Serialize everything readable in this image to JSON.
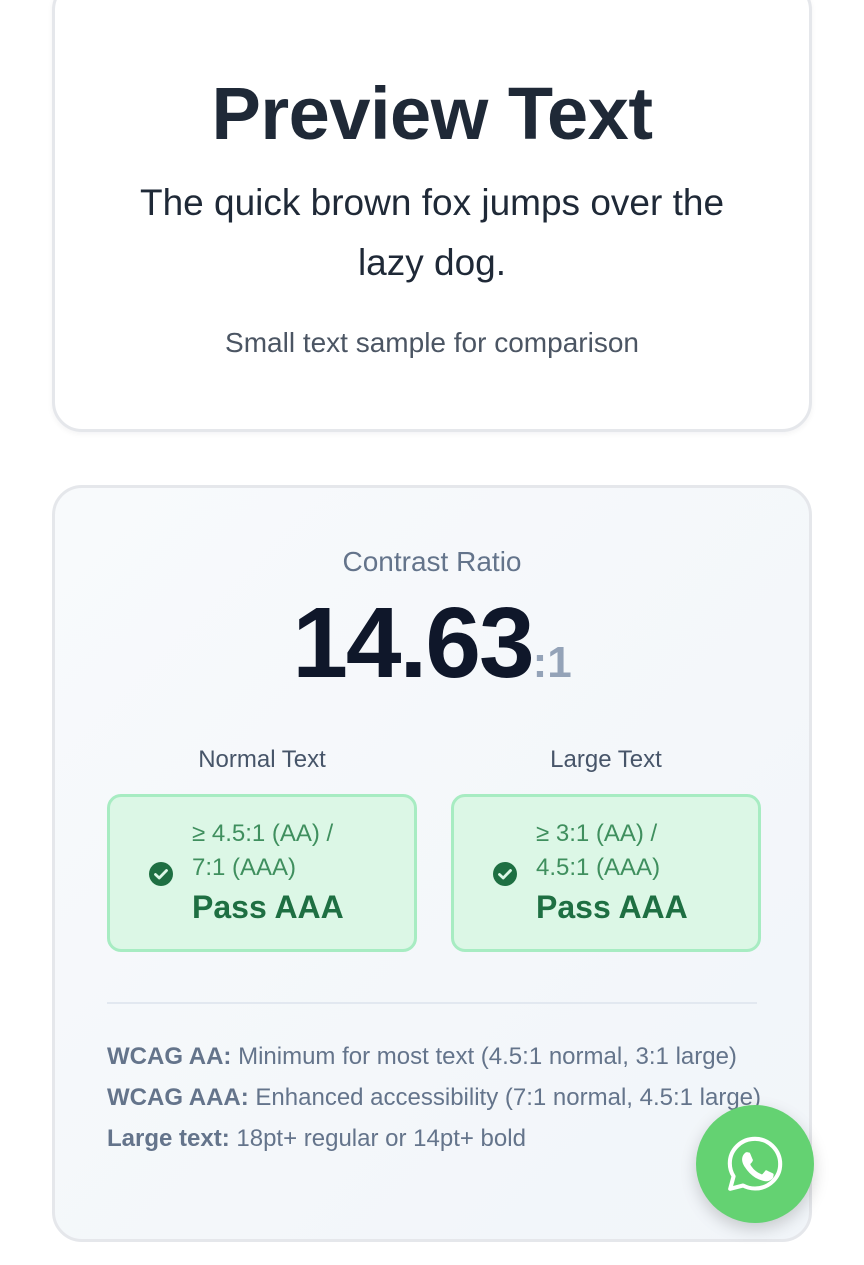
{
  "preview": {
    "title": "Preview Text",
    "body": "The quick brown fox jumps over the lazy dog.",
    "small": "Small text sample for comparison"
  },
  "contrast": {
    "label": "Contrast Ratio",
    "value": "14.63",
    "suffix": ":1",
    "normal": {
      "label": "Normal Text",
      "req_line1": "≥ 4.5:1 (AA) /",
      "req_line2": "7:1 (AAA)",
      "status": "Pass AAA"
    },
    "large": {
      "label": "Large Text",
      "req_line1": "≥ 3:1 (AA) /",
      "req_line2": "4.5:1 (AAA)",
      "status": "Pass AAA"
    },
    "notes": [
      {
        "term": "WCAG AA:",
        "text": " Minimum for most text (4.5:1 normal, 3:1 large)"
      },
      {
        "term": "WCAG AAA:",
        "text": " Enhanced accessibility (7:1 normal, 4.5:1 large)"
      },
      {
        "term": "Large text:",
        "text": " 18pt+ regular or 14pt+ bold"
      }
    ]
  },
  "fab": {
    "icon": "whatsapp-icon",
    "color": "#64d272"
  },
  "colors": {
    "pass_bg": "#dcf7e6",
    "pass_border": "#a7ecc2",
    "pass_text": "#1e6f42"
  }
}
